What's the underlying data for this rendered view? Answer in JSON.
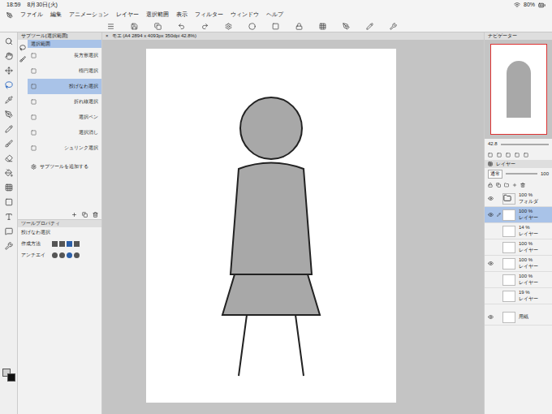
{
  "status_bar": {
    "time": "18:59",
    "date": "8月30日(火)",
    "battery": "80%"
  },
  "menu": [
    "ファイル",
    "編集",
    "アニメーション",
    "レイヤー",
    "選択範囲",
    "表示",
    "フィルター",
    "ウィンドウ",
    "ヘルプ"
  ],
  "subtool_panel": {
    "title": "サブツール[選択範囲]",
    "group": {
      "label": "選択範囲",
      "selected": true
    },
    "items": [
      {
        "label": "長方形選択",
        "selected": false
      },
      {
        "label": "楕円選択",
        "selected": false
      },
      {
        "label": "投げなわ選択",
        "selected": true
      },
      {
        "label": "折れ線選択",
        "selected": false
      },
      {
        "label": "選択ペン",
        "selected": false
      },
      {
        "label": "選択消し",
        "selected": false
      },
      {
        "label": "シュリンク選択",
        "selected": false
      }
    ],
    "add_label": "サブツールを追加する"
  },
  "tool_property": {
    "title": "ツールプロパティ",
    "tool_name": "投げなわ選択",
    "rows": [
      {
        "label": "作成方法"
      },
      {
        "label": "アンチエイ"
      }
    ]
  },
  "document_tab": {
    "title": "モエ (A4 2894 x 4093px 350dpi 42.8%)",
    "close": "×"
  },
  "navigator": {
    "title": "ナビゲーター",
    "zoom": "42.8"
  },
  "layer_panel": {
    "title": "レイヤー",
    "blend": "通常",
    "opacity": "100",
    "layers": [
      {
        "kind": "folder",
        "opacity": "100 %",
        "name": "フォルダ",
        "visible": true,
        "selected": false
      },
      {
        "kind": "layer",
        "opacity": "100 %",
        "name": "レイヤー",
        "visible": true,
        "selected": true
      },
      {
        "kind": "layer",
        "opacity": "14 %",
        "name": "レイヤー",
        "visible": false,
        "selected": false
      },
      {
        "kind": "layer",
        "opacity": "100 %",
        "name": "レイヤー",
        "visible": false,
        "selected": false
      },
      {
        "kind": "layer",
        "opacity": "100 %",
        "name": "レイヤー",
        "visible": true,
        "selected": false
      },
      {
        "kind": "layer",
        "opacity": "100 %",
        "name": "レイヤー",
        "visible": false,
        "selected": false
      },
      {
        "kind": "layer",
        "opacity": "19 %",
        "name": "レイヤー",
        "visible": false,
        "selected": false
      },
      {
        "kind": "paper",
        "opacity": "",
        "name": "用紙",
        "visible": true,
        "selected": false
      }
    ]
  }
}
